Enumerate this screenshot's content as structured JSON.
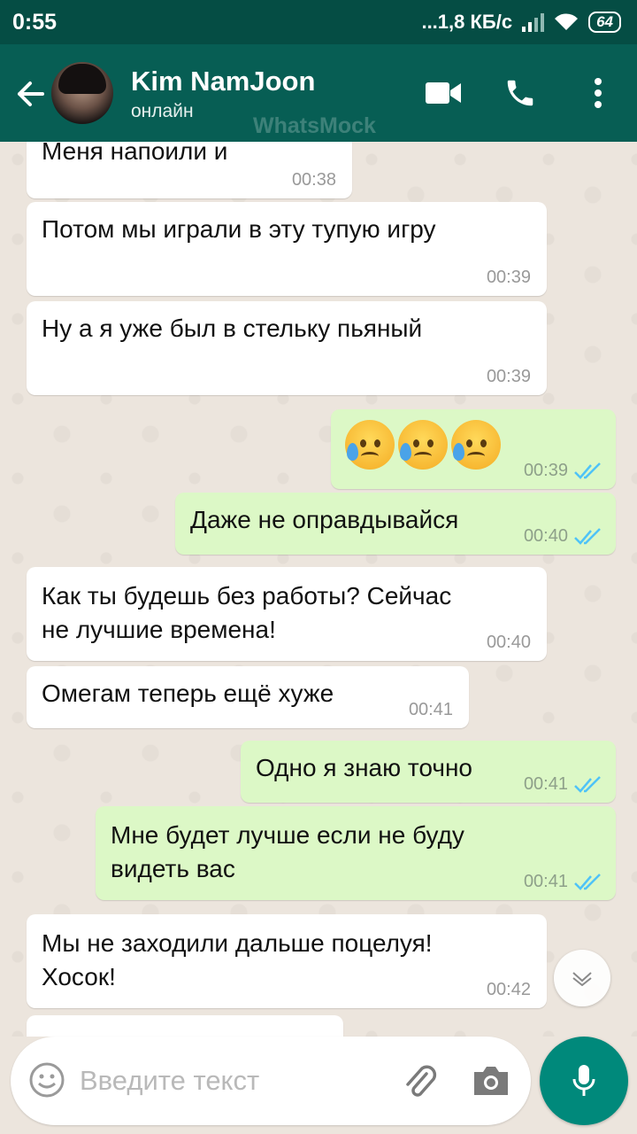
{
  "status_bar": {
    "time": "0:55",
    "network": "...1,8 КБ/с",
    "battery": "64"
  },
  "header": {
    "contact_name": "Kim NamJoon",
    "status": "онлайн",
    "watermark": "WhatsMock"
  },
  "messages": [
    {
      "dir": "in",
      "text": "Меня напоили и",
      "time": "00:38"
    },
    {
      "dir": "in",
      "text": "Потом мы играли в эту тупую игру",
      "time": "00:39"
    },
    {
      "dir": "in",
      "text": "Ну а я уже был в стельку пьяный",
      "time": "00:39"
    },
    {
      "dir": "out",
      "emoji": [
        "disappointed-relieved",
        "disappointed-relieved",
        "disappointed-relieved"
      ],
      "time": "00:39"
    },
    {
      "dir": "out",
      "text": "Даже не оправдывайся",
      "time": "00:40"
    },
    {
      "dir": "in",
      "text": "Как ты будешь без работы? Сейчас\nне лучшие времена!",
      "time": "00:40"
    },
    {
      "dir": "in",
      "text": "Омегам теперь ещё хуже",
      "time": "00:41"
    },
    {
      "dir": "out",
      "text": "Одно я знаю точно",
      "time": "00:41"
    },
    {
      "dir": "out",
      "text": "Мне будет лучше если не буду\nвидеть вас",
      "time": "00:41"
    },
    {
      "dir": "in",
      "text": "Мы не заходили дальше поцелуя!\nХосок!",
      "time": "00:42"
    }
  ],
  "composer": {
    "placeholder": "Введите текст"
  },
  "colors": {
    "header": "#075e54",
    "status_bar": "#054d44",
    "incoming_bubble": "#ffffff",
    "outgoing_bubble": "#dcf8c6",
    "read_ticks": "#4fc3f7",
    "mic_button": "#00897b"
  }
}
